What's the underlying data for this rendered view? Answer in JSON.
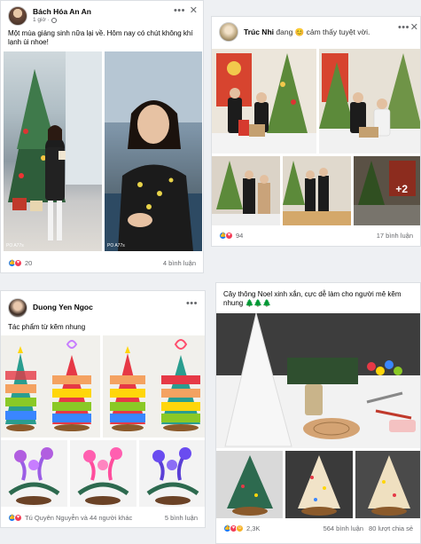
{
  "post1": {
    "name": "Bách Hóa An An",
    "time": "1 giờ ·",
    "caption": "Một mùa giáng sinh nữa lại về. Hôm nay có chút không khí lạnh ùi nhoe!",
    "reactions": "20",
    "comments": "4 bình luận",
    "watermark_a": "PO A77s",
    "watermark_b": "PO A77s"
  },
  "post2": {
    "name": "Trúc Nhi",
    "activity": "đang 😊 cảm thấy tuyệt vời.",
    "reactions": "94",
    "comments": "17 bình luận",
    "more_photos": "+2"
  },
  "post3": {
    "name": "Duong Yen Ngoc",
    "caption": "Tác phẩm từ kẽm nhung",
    "reactions": "Tú Quyên Nguyễn và 44 người khác",
    "comments": "5 bình luận"
  },
  "post4": {
    "caption": "Cây thông Noel xinh xắn, cực dễ làm cho người mê kẽm nhung 🌲🌲🌲",
    "reactions": "2,3K",
    "comments": "564 bình luận",
    "shares": "80 lượt chia sẻ"
  },
  "icons": {
    "more": "more-horizontal-icon",
    "close": "close-icon",
    "globe": "globe-icon",
    "like": "like-reaction-icon",
    "love": "love-reaction-icon",
    "care": "care-reaction-icon"
  },
  "colors": {
    "like": "#1877f2",
    "love": "#f33e58",
    "care": "#f7b125",
    "secondary_text": "#65676b"
  }
}
